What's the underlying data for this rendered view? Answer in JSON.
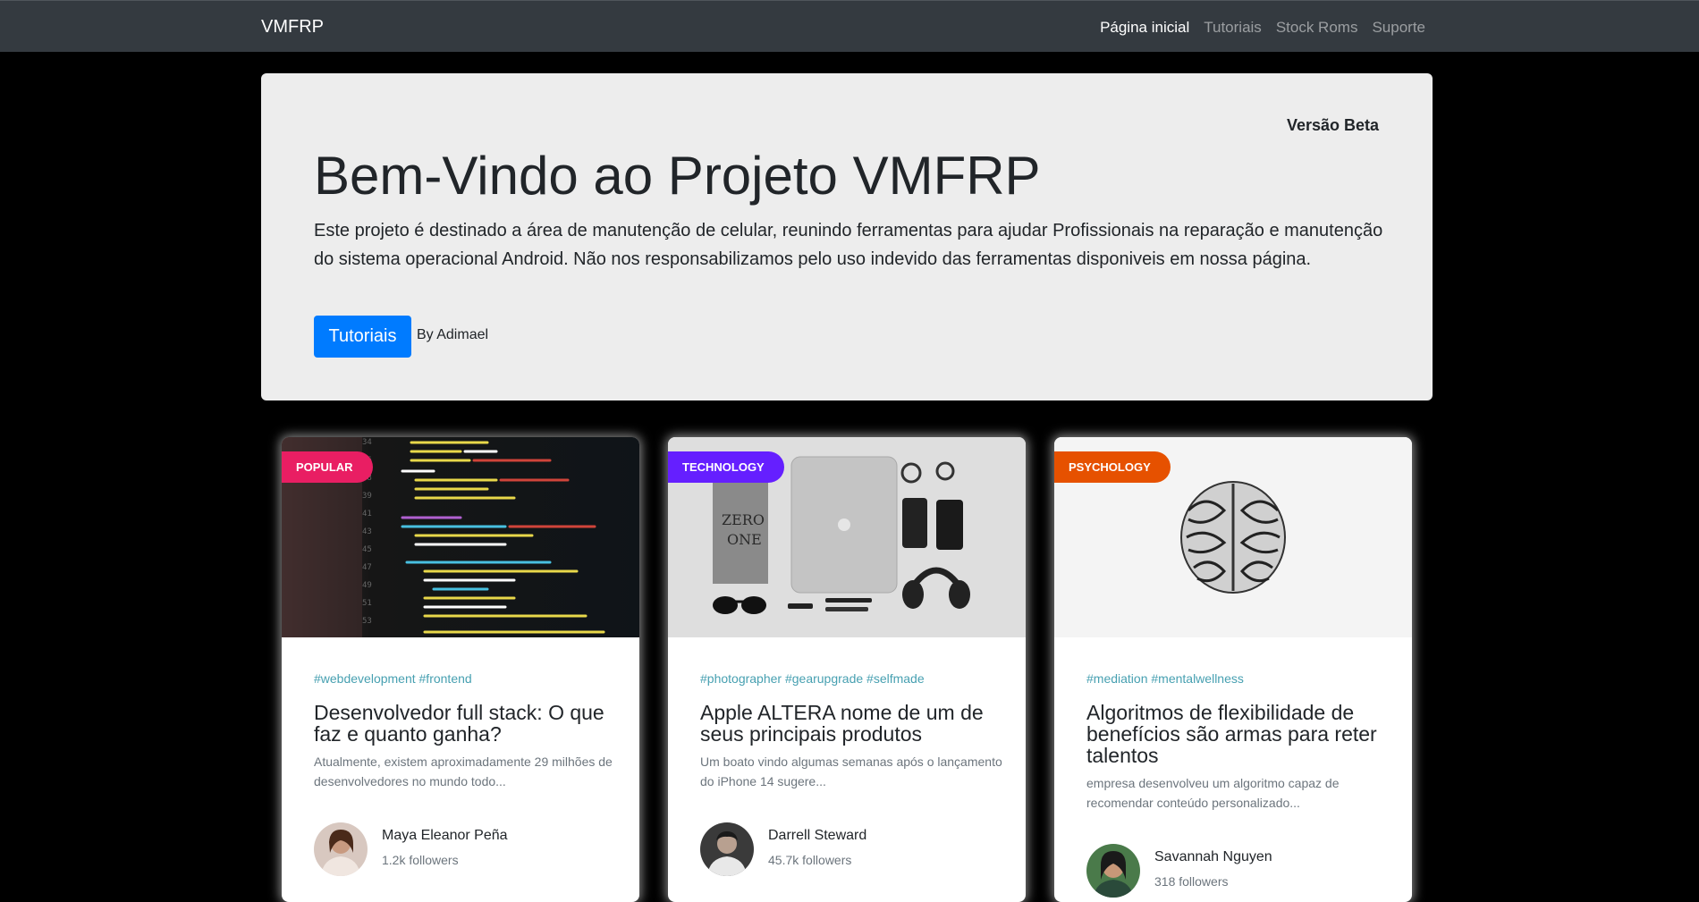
{
  "navbar": {
    "brand": "VMFRP",
    "links": [
      {
        "label": "Página inicial",
        "active": true
      },
      {
        "label": "Tutoriais",
        "active": false
      },
      {
        "label": "Stock Roms",
        "active": false
      },
      {
        "label": "Suporte",
        "active": false
      }
    ]
  },
  "hero": {
    "badge": "Versão Beta",
    "title": "Bem-Vindo ao Projeto VMFRP",
    "lead": "Este projeto é destinado a área de manutenção de celular, reunindo ferramentas para ajudar Profissionais na reparação e manutenção do sistema operacional Android. Não nos responsabilizamos pelo uso indevido das ferramentas disponiveis em nossa página.",
    "button_label": "Tutoriais",
    "byline": "By Adimael"
  },
  "cards": [
    {
      "badge": "POPULAR",
      "badge_color": "#e91e63",
      "tags": "#webdevelopment #frontend",
      "title": "Desenvolvedor full stack: O que faz e quanto ganha?",
      "description": "Atualmente, existem aproximadamente 29 milhões de desenvolvedores no mundo todo...",
      "author": "Maya Eleanor Peña",
      "followers": "1.2k followers"
    },
    {
      "badge": "TECHNOLOGY",
      "badge_color": "#651fff",
      "tags": "#photographer #gearupgrade #selfmade",
      "title": "Apple ALTERA nome de um de seus principais produtos",
      "description": "Um boato vindo algumas semanas após o lançamento do iPhone 14 sugere...",
      "author": "Darrell Steward",
      "followers": "45.7k followers"
    },
    {
      "badge": "PSYCHOLOGY",
      "badge_color": "#e65100",
      "tags": "#mediation #mentalwellness",
      "title": "Algoritmos de flexibilidade de benefícios são armas para reter talentos",
      "description": "empresa desenvolveu um algoritmo capaz de recomendar conteúdo personalizado...",
      "author": "Savannah Nguyen",
      "followers": "318 followers"
    }
  ]
}
